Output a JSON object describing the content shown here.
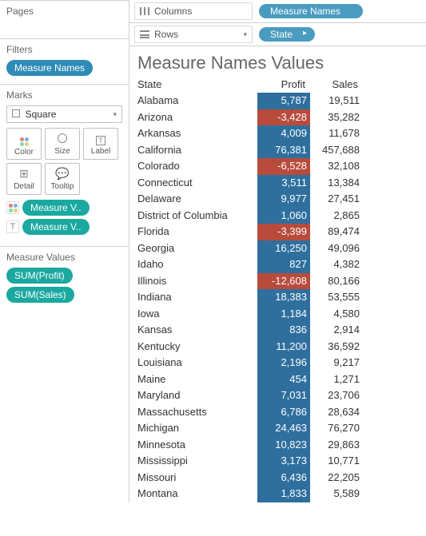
{
  "shelves": {
    "columns_label": "Columns",
    "rows_label": "Rows",
    "columns_pill": "Measure Names",
    "rows_pill": "State"
  },
  "panels": {
    "pages": "Pages",
    "filters": "Filters",
    "filter_pill": "Measure Names",
    "marks": "Marks",
    "mark_type": "Square",
    "color": "Color",
    "size": "Size",
    "label": "Label",
    "detail": "Detail",
    "tooltip": "Tooltip",
    "mark_pill_1": "Measure V..",
    "mark_pill_2": "Measure V..",
    "measure_values": "Measure Values",
    "mv_pill_1": "SUM(Profit)",
    "mv_pill_2": "SUM(Sales)"
  },
  "viz": {
    "title": "Measure Names Values",
    "col_state": "State",
    "col_profit": "Profit",
    "col_sales": "Sales",
    "rows": [
      {
        "state": "Alabama",
        "profit": "5,787",
        "sales": "19,511",
        "neg": false
      },
      {
        "state": "Arizona",
        "profit": "-3,428",
        "sales": "35,282",
        "neg": true
      },
      {
        "state": "Arkansas",
        "profit": "4,009",
        "sales": "11,678",
        "neg": false
      },
      {
        "state": "California",
        "profit": "76,381",
        "sales": "457,688",
        "neg": false
      },
      {
        "state": "Colorado",
        "profit": "-6,528",
        "sales": "32,108",
        "neg": true
      },
      {
        "state": "Connecticut",
        "profit": "3,511",
        "sales": "13,384",
        "neg": false
      },
      {
        "state": "Delaware",
        "profit": "9,977",
        "sales": "27,451",
        "neg": false
      },
      {
        "state": "District of Columbia",
        "profit": "1,060",
        "sales": "2,865",
        "neg": false
      },
      {
        "state": "Florida",
        "profit": "-3,399",
        "sales": "89,474",
        "neg": true
      },
      {
        "state": "Georgia",
        "profit": "16,250",
        "sales": "49,096",
        "neg": false
      },
      {
        "state": "Idaho",
        "profit": "827",
        "sales": "4,382",
        "neg": false
      },
      {
        "state": "Illinois",
        "profit": "-12,608",
        "sales": "80,166",
        "neg": true
      },
      {
        "state": "Indiana",
        "profit": "18,383",
        "sales": "53,555",
        "neg": false
      },
      {
        "state": "Iowa",
        "profit": "1,184",
        "sales": "4,580",
        "neg": false
      },
      {
        "state": "Kansas",
        "profit": "836",
        "sales": "2,914",
        "neg": false
      },
      {
        "state": "Kentucky",
        "profit": "11,200",
        "sales": "36,592",
        "neg": false
      },
      {
        "state": "Louisiana",
        "profit": "2,196",
        "sales": "9,217",
        "neg": false
      },
      {
        "state": "Maine",
        "profit": "454",
        "sales": "1,271",
        "neg": false
      },
      {
        "state": "Maryland",
        "profit": "7,031",
        "sales": "23,706",
        "neg": false
      },
      {
        "state": "Massachusetts",
        "profit": "6,786",
        "sales": "28,634",
        "neg": false
      },
      {
        "state": "Michigan",
        "profit": "24,463",
        "sales": "76,270",
        "neg": false
      },
      {
        "state": "Minnesota",
        "profit": "10,823",
        "sales": "29,863",
        "neg": false
      },
      {
        "state": "Mississippi",
        "profit": "3,173",
        "sales": "10,771",
        "neg": false
      },
      {
        "state": "Missouri",
        "profit": "6,436",
        "sales": "22,205",
        "neg": false
      },
      {
        "state": "Montana",
        "profit": "1,833",
        "sales": "5,589",
        "neg": false
      }
    ]
  }
}
